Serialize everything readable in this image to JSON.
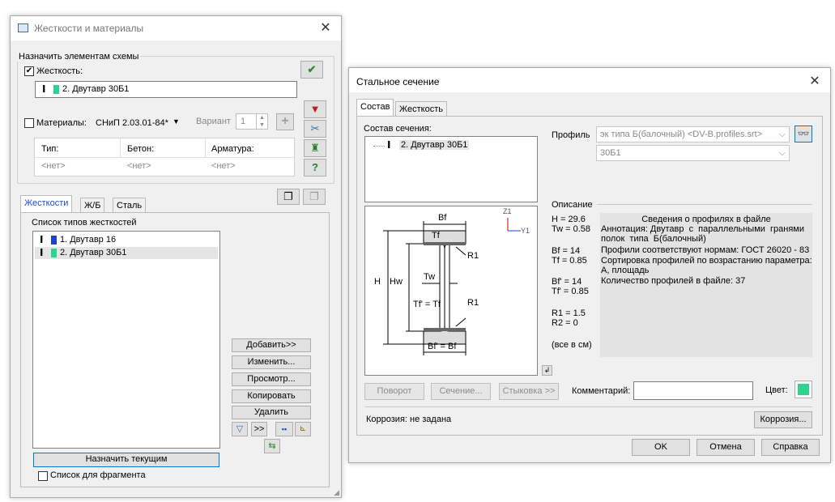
{
  "left_window": {
    "title": "Жесткости и материалы",
    "assign_group_label": "Назначить элементам схемы",
    "stiffness_checkbox_label": "Жесткость:",
    "selected_stiffness": "2. Двутавр 30Б1",
    "materials_checkbox_label": "Материалы:",
    "materials_norm": "СНиП 2.03.01-84*",
    "variant_label": "Вариант",
    "variant_value": "1",
    "materials_table": {
      "headers": [
        "Тип:",
        "Бетон:",
        "Арматура:"
      ],
      "values": [
        "<нет>",
        "<нет>",
        "<нет>"
      ]
    },
    "tabs": [
      "Жесткости",
      "Ж/Б",
      "Сталь"
    ],
    "list_title": "Список типов жесткостей",
    "list_items": [
      {
        "label": "1. Двутавр 16",
        "color": "#1f3fd6"
      },
      {
        "label": "2. Двутавр 30Б1",
        "color": "#2ed38f"
      }
    ],
    "buttons": {
      "add": "Добавить>>",
      "edit": "Изменить...",
      "view": "Просмотр...",
      "copy": "Копировать",
      "delete": "Удалить",
      "assign_current": "Назначить текущим",
      "more": ">>"
    },
    "fragment_checkbox_label": "Список для фрагмента"
  },
  "right_window": {
    "title": "Стальное сечение",
    "tabs": [
      "Состав",
      "Жесткость"
    ],
    "composition_label": "Состав сечения:",
    "composition_item": "2. Двутавр 30Б1",
    "profile_label": "Профиль",
    "profile_value": "эк типа Б(балочный) <DV-B.profiles.srt>",
    "profile_size": "30Б1",
    "description_label": "Описание",
    "params": {
      "H": "H = 29.6",
      "Tw": "Tw = 0.58",
      "Bf": "Bf = 14",
      "Tf": "Tf = 0.85",
      "Bf2": "Bf' = 14",
      "Tf2": "Tf' = 0.85",
      "R1": "R1 = 1.5",
      "R2": "R2 = 0",
      "units": "(все в см)"
    },
    "info_title": "Сведения о профилях в файле",
    "info_lines": [
      "Аннотация: Двутавр  с  параллельными  гранями",
      "полок  типа  Б(балочный)",
      "Профили соответствуют нормам: ГОСТ 26020 - 83",
      "Сортировка профилей по возрастанию параметра:",
      "А, площадь",
      "Количество профилей в файле: 37"
    ],
    "diagram_labels": {
      "Bf": "Bf",
      "Tf": "Tf",
      "R1a": "R1",
      "Tw": "Tw",
      "H": "H",
      "Hw": "Hw",
      "TfEq": "Tf' = Tf",
      "R1b": "R1",
      "BfEq": "Bf' = Bf",
      "Z1": "Z1",
      "Y1": "Y1"
    },
    "buttons": {
      "rotate": "Поворот",
      "section": "Сечение...",
      "joint": "Стыковка >>",
      "corrosion": "Коррозия...",
      "ok": "OK",
      "cancel": "Отмена",
      "help": "Справка"
    },
    "comment_label": "Комментарий:",
    "color_label": "Цвет:",
    "color_value": "#2ed38f",
    "corrosion_status": "Коррозия: не задана"
  }
}
